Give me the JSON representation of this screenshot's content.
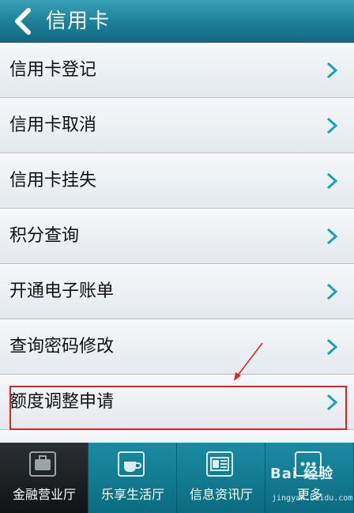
{
  "header": {
    "title": "信用卡",
    "back_icon": "chevron-left-icon"
  },
  "menu": {
    "items": [
      {
        "label": "信用卡登记"
      },
      {
        "label": "信用卡取消"
      },
      {
        "label": "信用卡挂失"
      },
      {
        "label": "积分查询"
      },
      {
        "label": "开通电子账单"
      },
      {
        "label": "查询密码修改"
      },
      {
        "label": "额度调整申请"
      }
    ],
    "chevron_icon": "chevron-right-icon",
    "chevron_color": "#1aa3b8"
  },
  "annotation": {
    "highlighted_item": "额度调整申请",
    "color": "#e0202a"
  },
  "tabbar": {
    "tabs": [
      {
        "label": "金融营业厅",
        "icon": "briefcase-icon",
        "active": true
      },
      {
        "label": "乐享生活厅",
        "icon": "coffee-cup-icon",
        "active": false
      },
      {
        "label": "信息资讯厅",
        "icon": "newspaper-icon",
        "active": false
      },
      {
        "label": "更多",
        "icon": "more-icon",
        "active": false
      }
    ]
  },
  "watermark": {
    "brand": "Bai 经验",
    "url": "jingyan.baidu.com"
  },
  "colors": {
    "header": "#1d7f98",
    "tabbar": "#0c6b80",
    "active_tab": "#1a1e21"
  }
}
